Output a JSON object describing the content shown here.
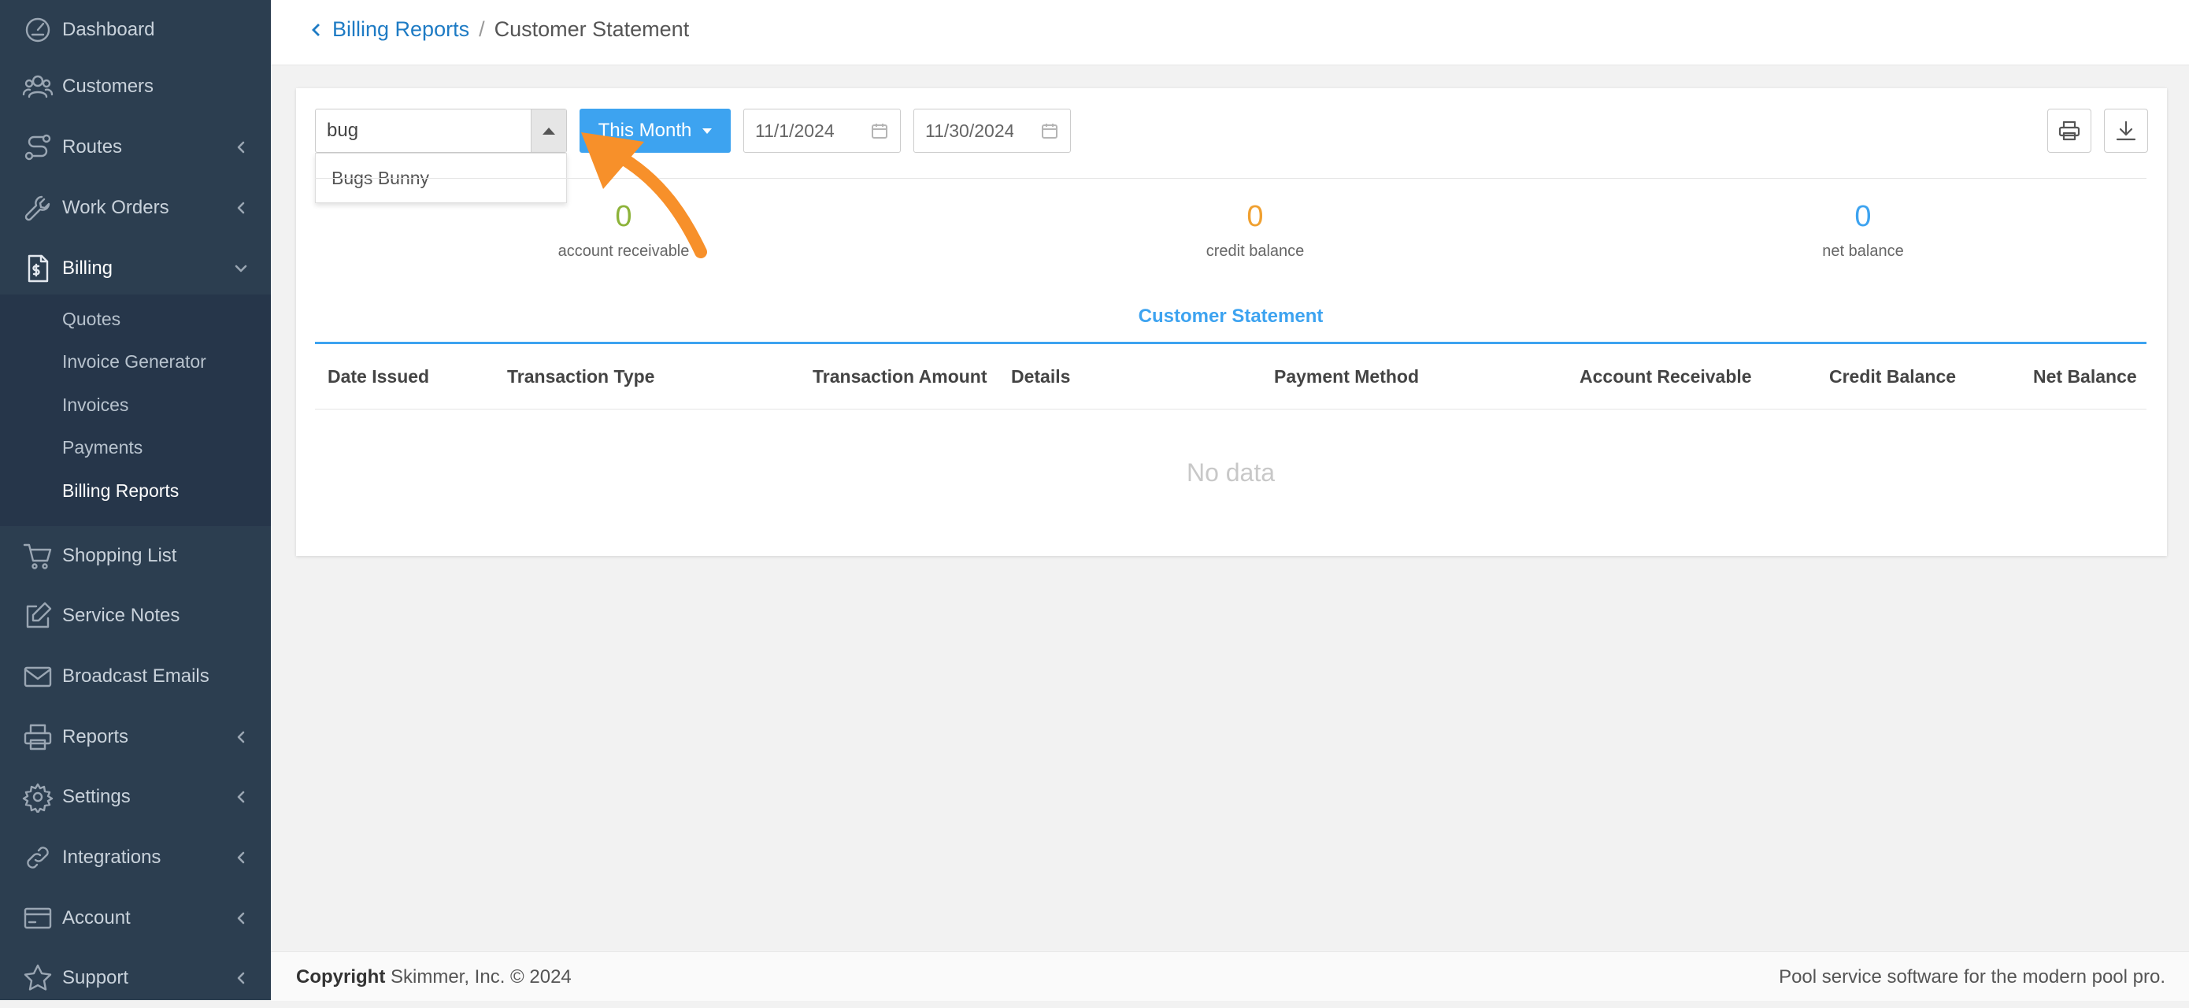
{
  "sidebar": {
    "items": [
      {
        "label": "Dashboard",
        "icon": "dashboard-icon"
      },
      {
        "label": "Customers",
        "icon": "customers-icon"
      },
      {
        "label": "Routes",
        "icon": "routes-icon"
      },
      {
        "label": "Work Orders",
        "icon": "wrench-icon"
      },
      {
        "label": "Billing",
        "icon": "billing-icon"
      },
      {
        "label": "Shopping List",
        "icon": "cart-icon"
      },
      {
        "label": "Service Notes",
        "icon": "edit-icon"
      },
      {
        "label": "Broadcast Emails",
        "icon": "mail-icon"
      },
      {
        "label": "Reports",
        "icon": "printer-icon"
      },
      {
        "label": "Settings",
        "icon": "gear-icon"
      },
      {
        "label": "Integrations",
        "icon": "link-icon"
      },
      {
        "label": "Account",
        "icon": "card-icon"
      },
      {
        "label": "Support",
        "icon": "star-icon"
      }
    ],
    "billing_sub": [
      "Quotes",
      "Invoice Generator",
      "Invoices",
      "Payments",
      "Billing Reports"
    ]
  },
  "breadcrumb": {
    "parent": "Billing Reports",
    "separator": "/",
    "current": "Customer Statement"
  },
  "filters": {
    "customer_search": "bug",
    "dropdown_option": "Bugs Bunny",
    "period": "This Month",
    "start_date": "11/1/2024",
    "end_date": "11/30/2024"
  },
  "summary": {
    "receivable": {
      "value": "0",
      "label": "account receivable",
      "color": "#8db33a"
    },
    "credit": {
      "value": "0",
      "label": "credit balance",
      "color": "#f0a030"
    },
    "net": {
      "value": "0",
      "label": "net balance",
      "color": "#3da3f0"
    }
  },
  "table": {
    "title": "Customer Statement",
    "columns": [
      "Date Issued",
      "Transaction Type",
      "Transaction Amount",
      "Details",
      "Payment Method",
      "Account Receivable",
      "Credit Balance",
      "Net Balance"
    ],
    "empty_text": "No data"
  },
  "footer": {
    "copyright_bold": "Copyright",
    "copyright_rest": " Skimmer, Inc. © 2024",
    "tagline": "Pool service software for the modern pool pro."
  },
  "colors": {
    "sidebar": "#2c3e50",
    "accent": "#3da3f0",
    "annotation_arrow": "#f7902a"
  }
}
